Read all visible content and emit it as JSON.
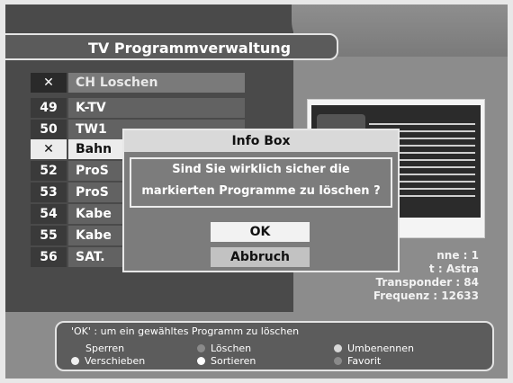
{
  "header": {
    "title": "TV Programmverwaltung"
  },
  "channels": [
    {
      "num": "✕",
      "name": "CH Loschen"
    },
    {
      "num": "49",
      "name": "K-TV"
    },
    {
      "num": "50",
      "name": "TW1"
    },
    {
      "num": "✕",
      "name": "Bahn"
    },
    {
      "num": "52",
      "name": "ProS"
    },
    {
      "num": "53",
      "name": "ProS"
    },
    {
      "num": "54",
      "name": "Kabe"
    },
    {
      "num": "55",
      "name": "Kabe"
    },
    {
      "num": "56",
      "name": "SAT."
    }
  ],
  "info": {
    "line1": "nne : 1",
    "line2": "t : Astra",
    "line3": "Transponder : 84",
    "line4": "Frequenz : 12633"
  },
  "dialog": {
    "title": "Info Box",
    "message_line1": "Sind Sie wirklich sicher die",
    "message_line2": "markierten Programme zu löschen ?",
    "ok_label": "OK",
    "cancel_label": "Abbruch"
  },
  "help": {
    "hint": "'OK' : um ein gewähltes Programm zu löschen",
    "sperren": "Sperren",
    "loeschen": "Löschen",
    "umbenennen": "Umbenennen",
    "verschieben": "Verschieben",
    "sortieren": "Sortieren",
    "favorit": "Favorit"
  },
  "colors": {
    "panel": "#4a4a4a",
    "background": "#8c8c8c",
    "dialog": "#7c7c7c",
    "highlight": "#ececec"
  },
  "icons": {
    "delete_mark": "x-mark-icon"
  }
}
